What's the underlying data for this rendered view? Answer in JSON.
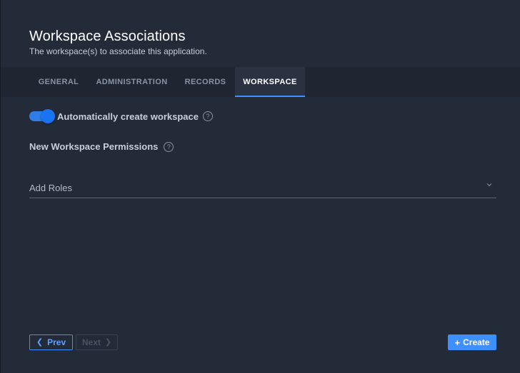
{
  "header": {
    "title": "Workspace Associations",
    "subtitle": "The workspace(s) to associate this application."
  },
  "tabs": [
    {
      "label": "GENERAL",
      "active": false
    },
    {
      "label": "ADMINISTRATION",
      "active": false
    },
    {
      "label": "RECORDS",
      "active": false
    },
    {
      "label": "WORKSPACE",
      "active": true
    }
  ],
  "workspace": {
    "auto_create": {
      "label": "Automatically create workspace",
      "enabled": true,
      "help_icon": "question-circle-icon"
    },
    "permissions": {
      "label": "New Workspace Permissions",
      "help_icon": "question-circle-icon"
    },
    "roles": {
      "placeholder": "Add Roles",
      "icon": "chevron-down-icon"
    }
  },
  "footer": {
    "prev_label": "Prev",
    "next_label": "Next",
    "create_label": "Create"
  },
  "colors": {
    "accent": "#3e8fff",
    "background": "#232a38",
    "tabbar": "#1f2531"
  }
}
